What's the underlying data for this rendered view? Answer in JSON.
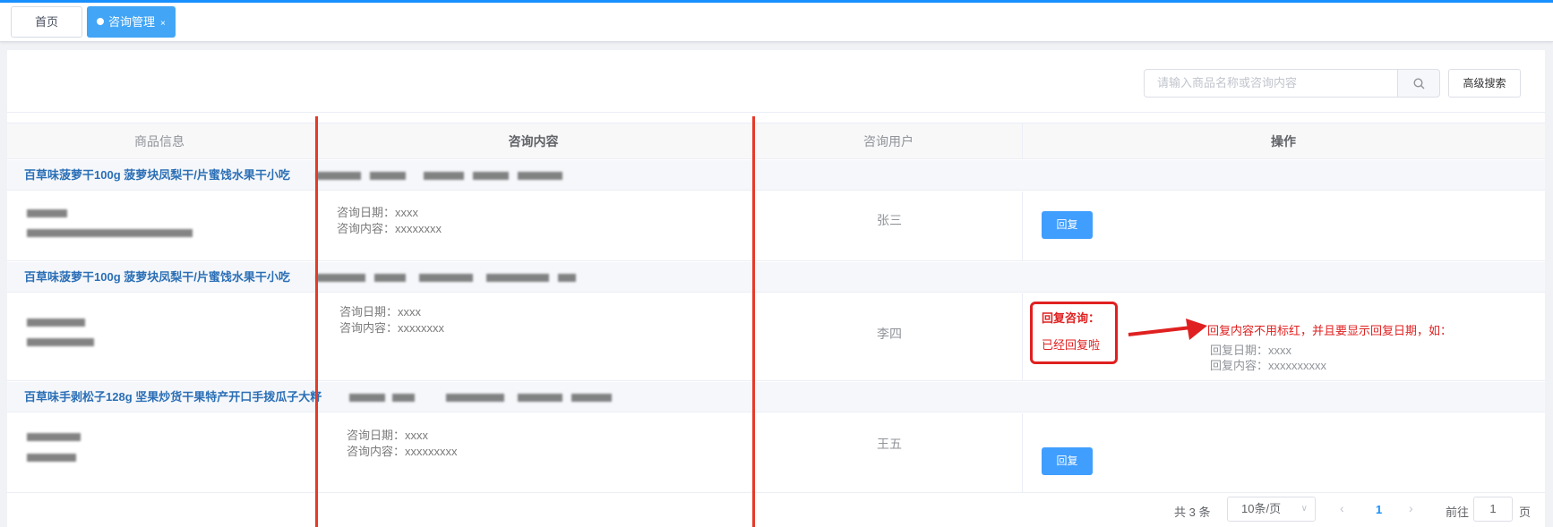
{
  "tabs": {
    "home": "首页",
    "active": "咨询管理",
    "close": "×"
  },
  "search": {
    "placeholder": "请输入商品名称或咨询内容",
    "advanced": "高级搜索"
  },
  "table": {
    "headers": {
      "product": "商品信息",
      "content": "咨询内容",
      "user": "咨询用户",
      "action": "操作"
    },
    "groups": [
      {
        "product": "百草味菠萝干100g 菠萝块凤梨干/片蜜饯水果干小吃",
        "date_line": "咨询日期：xxxx",
        "content_line": "咨询内容：xxxxxxxx",
        "user": "张三",
        "reply_label": "回复"
      },
      {
        "product": "百草味菠萝干100g 菠萝块凤梨干/片蜜饯水果干小吃",
        "date_line": "咨询日期：xxxx",
        "content_line": "咨询内容：xxxxxxxx",
        "user": "李四",
        "reply_title": "回复咨询：",
        "reply_text": "已经回复啦"
      },
      {
        "product": "百草味手剥松子128g 坚果炒货干果特产开口手拨瓜子大籽",
        "date_line": "咨询日期：xxxx",
        "content_line": "咨询内容：xxxxxxxxx",
        "user": "王五",
        "reply_label": "回复"
      }
    ]
  },
  "annotation": {
    "text": "回复内容不用标红，并且要显示回复日期，如：",
    "date_line": "回复日期：xxxx",
    "content_line": "回复内容：xxxxxxxxxx"
  },
  "pagination": {
    "total": "共 3 条",
    "page_size": "10条/页",
    "current_page": "1",
    "goto_label": "前往",
    "goto_value": "1",
    "page_unit": "页"
  },
  "colors": {
    "accent": "#409eff",
    "annotation": "#e02020",
    "link": "#2b6fb6"
  }
}
